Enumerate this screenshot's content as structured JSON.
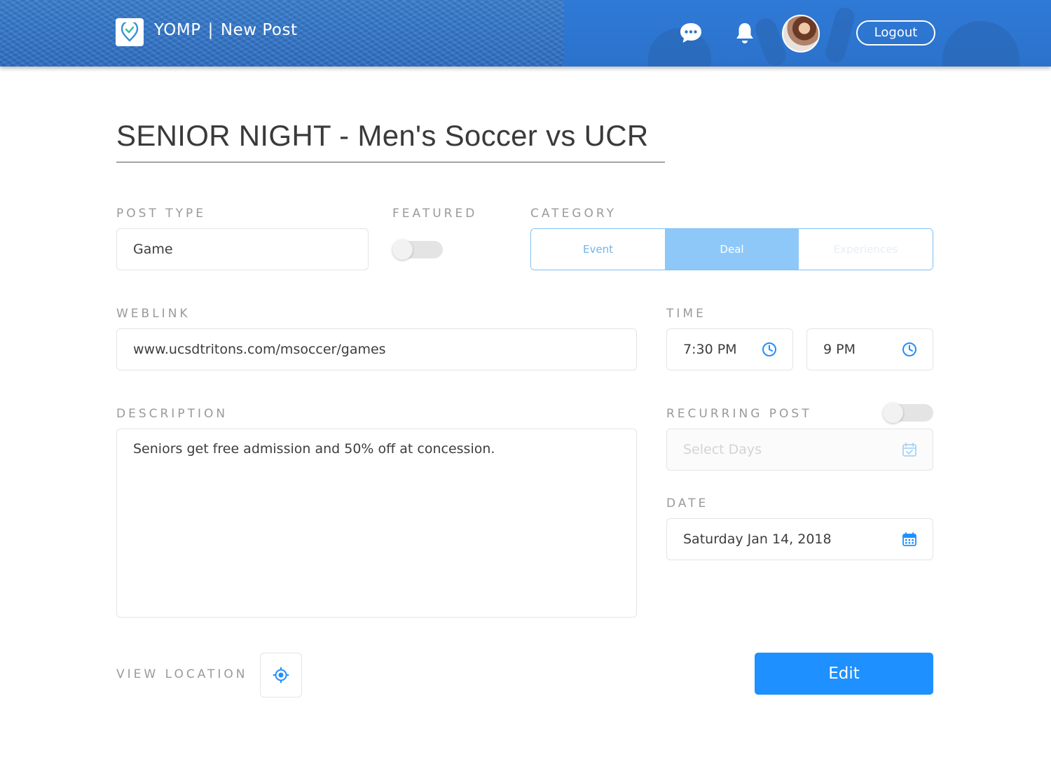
{
  "header": {
    "brand": "YOMP",
    "separator": "|",
    "page": "New Post",
    "logout_label": "Logout",
    "colors": {
      "bar": "#2e76c9",
      "bar_left": "#3a7fd0"
    }
  },
  "post": {
    "title": "SENIOR NIGHT - Men's Soccer vs UCR"
  },
  "form": {
    "post_type": {
      "label": "POST TYPE",
      "value": "Game"
    },
    "featured": {
      "label": "FEATURED",
      "on": false
    },
    "category": {
      "label": "CATEGORY",
      "options": [
        "Event",
        "Deal",
        "Experiences"
      ],
      "selected": "Deal"
    },
    "weblink": {
      "label": "WEBLINK",
      "value": "www.ucsdtritons.com/msoccer/games"
    },
    "time": {
      "label": "TIME",
      "start": "7:30 PM",
      "end": "9 PM"
    },
    "description": {
      "label": "DESCRIPTION",
      "value": "Seniors get free admission and 50% off at concession."
    },
    "recurring": {
      "label": "RECURRING POST",
      "on": false,
      "placeholder": "Select Days"
    },
    "date": {
      "label": "DATE",
      "value": "Saturday Jan 14, 2018"
    },
    "view_location": {
      "label": "VIEW LOCATION"
    },
    "edit_label": "Edit"
  },
  "icons": {
    "logo": "yomp-logo-icon",
    "chat": "chat-icon",
    "bell": "bell-icon",
    "clock": "clock-icon",
    "calendar_check": "calendar-check-icon",
    "calendar": "calendar-icon",
    "location": "location-target-icon"
  },
  "accent": "#1e90ff"
}
